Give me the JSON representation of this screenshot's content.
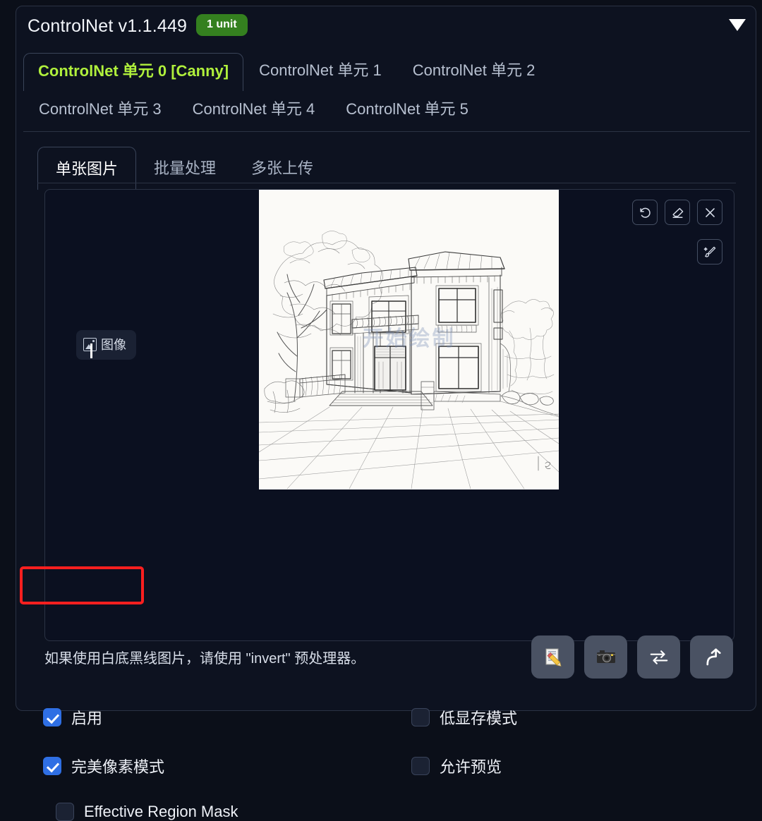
{
  "header": {
    "title": "ControlNet v1.1.449",
    "badge": "1 unit",
    "collapse_icon": "chevron-down-icon"
  },
  "unit_tabs": {
    "row1": [
      {
        "label": "ControlNet 单元 0 [Canny]",
        "active": true
      },
      {
        "label": "ControlNet 单元 1",
        "active": false
      },
      {
        "label": "ControlNet 单元 2",
        "active": false
      }
    ],
    "row2": [
      {
        "label": "ControlNet 单元 3",
        "active": false
      },
      {
        "label": "ControlNet 单元 4",
        "active": false
      },
      {
        "label": "ControlNet 单元 5",
        "active": false
      }
    ],
    "active_color": "#b0f03c"
  },
  "source_tabs": [
    {
      "label": "单张图片",
      "active": true
    },
    {
      "label": "批量处理",
      "active": false
    },
    {
      "label": "多张上传",
      "active": false
    }
  ],
  "image_panel": {
    "label": "图像",
    "label_icon": "image-icon",
    "image_description": "铅笔手绘别墅建筑效果图，两层洋房带阳台、台阶与庭院树木",
    "watermark": "开始绘制",
    "tools": [
      {
        "name": "undo-icon",
        "title": "撤销"
      },
      {
        "name": "eraser-icon",
        "title": "橡皮擦"
      },
      {
        "name": "close-icon",
        "title": "移除"
      }
    ],
    "tools_secondary": [
      {
        "name": "brush-sparkle-icon",
        "title": "画笔"
      }
    ]
  },
  "hint": "如果使用白底黑线图片，请使用 \"invert\" 预处理器。",
  "actions": [
    {
      "name": "memo-button",
      "glyph": "📝"
    },
    {
      "name": "camera-button",
      "glyph": "📷"
    },
    {
      "name": "swap-button",
      "glyph": "⇄"
    },
    {
      "name": "upload-arrow-button",
      "glyph": "⬆"
    }
  ],
  "checkboxes": {
    "left": [
      {
        "label": "启用",
        "checked": true,
        "highlighted": true
      },
      {
        "label": "完美像素模式",
        "checked": true,
        "highlighted": false
      },
      {
        "label": "Effective Region Mask",
        "checked": false,
        "highlighted": false
      }
    ],
    "right": [
      {
        "label": "低显存模式",
        "checked": false
      },
      {
        "label": "允许预览",
        "checked": false
      }
    ]
  },
  "colors": {
    "background": "#0b0f19",
    "panel": "#0d1220",
    "accent_green": "#b0f03c",
    "badge_green": "#34801f",
    "checkbox_blue": "#2f6fe4",
    "highlight_red": "#fb1f1f",
    "border": "#2b3344"
  }
}
